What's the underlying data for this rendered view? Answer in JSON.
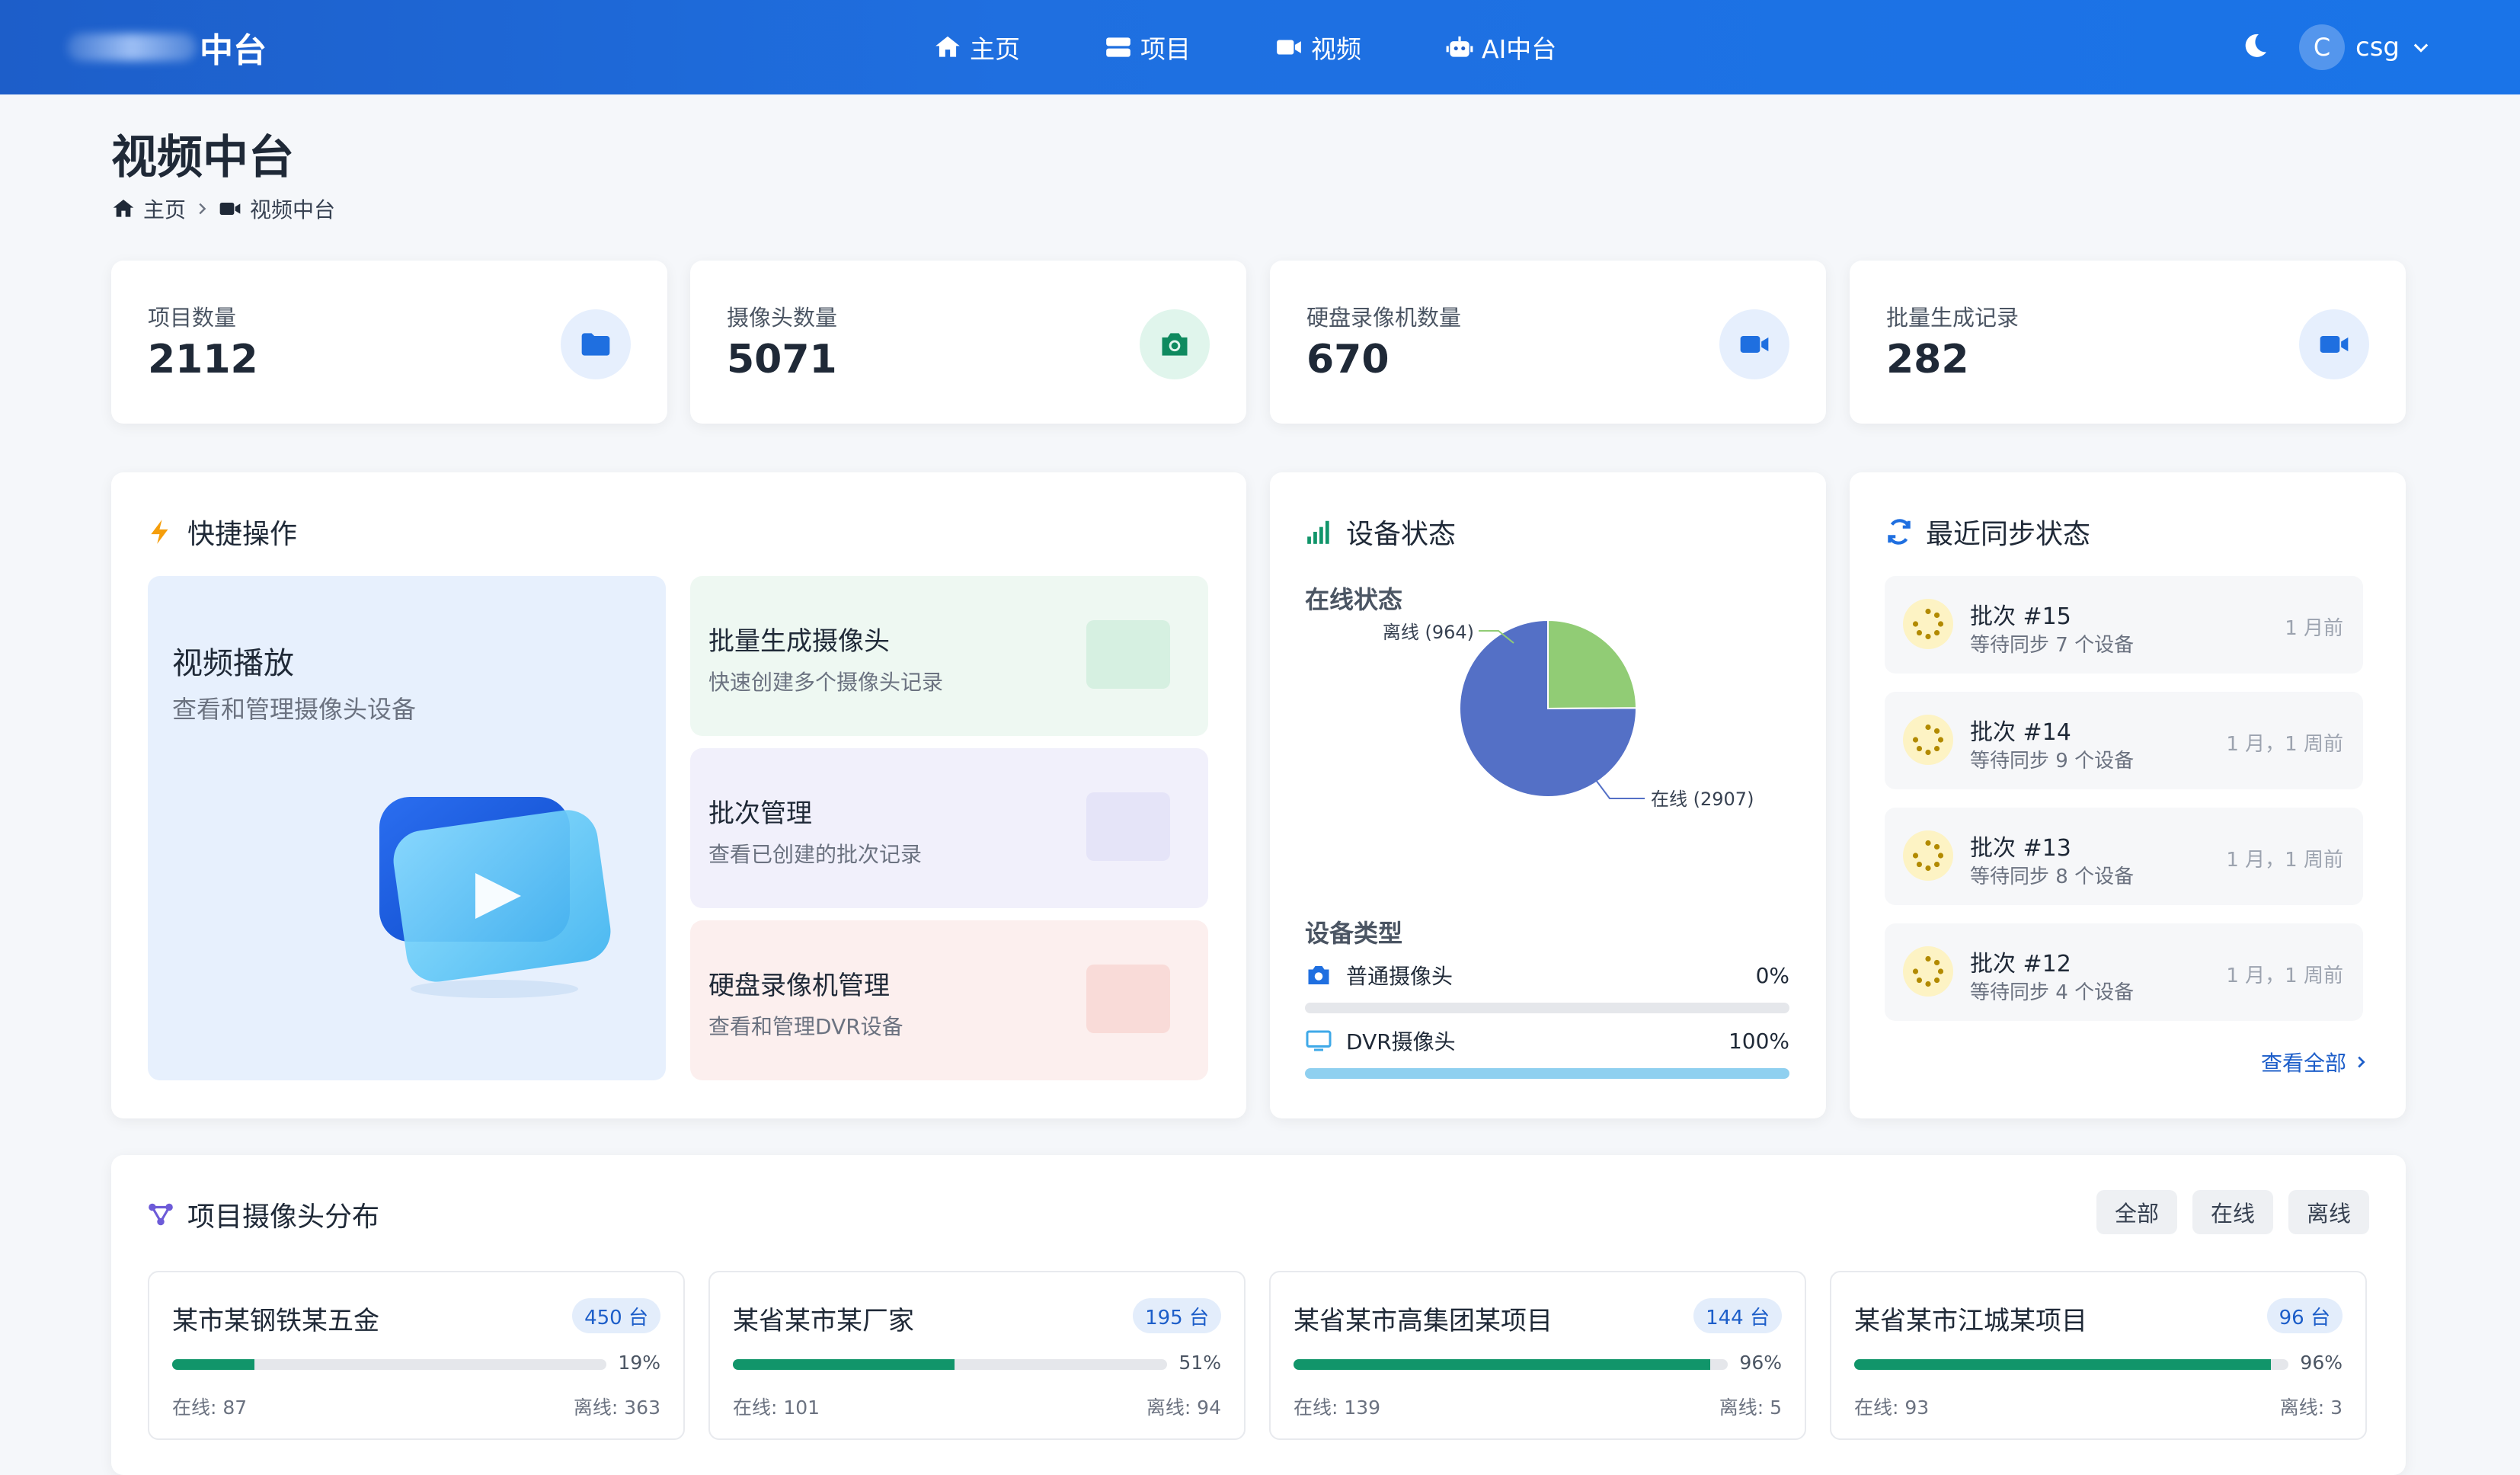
{
  "header": {
    "brand_suffix": "中台",
    "nav": [
      {
        "label": "主页",
        "icon": "home-icon"
      },
      {
        "label": "项目",
        "icon": "server-icon"
      },
      {
        "label": "视频",
        "icon": "video-icon"
      },
      {
        "label": "AI中台",
        "icon": "robot-icon"
      }
    ],
    "user": {
      "initial": "C",
      "name": "csg"
    }
  },
  "page": {
    "title": "视频中台",
    "breadcrumb": [
      "主页",
      "视频中台"
    ]
  },
  "stats": [
    {
      "label": "项目数量",
      "value": "2112",
      "icon": "folder-icon",
      "color": "#1f6fe0",
      "bg": "#e6effd"
    },
    {
      "label": "摄像头数量",
      "value": "5071",
      "icon": "camera-icon",
      "color": "#0f8a5f",
      "bg": "#e0f5ec"
    },
    {
      "label": "硬盘录像机数量",
      "value": "670",
      "icon": "video-camera-icon",
      "color": "#1f6fe0",
      "bg": "#e6effd"
    },
    {
      "label": "批量生成记录",
      "value": "282",
      "icon": "video-camera-icon",
      "color": "#1f6fe0",
      "bg": "#e6effd"
    }
  ],
  "quick_actions": {
    "title": "快捷操作",
    "main": {
      "title": "视频播放",
      "subtitle": "查看和管理摄像头设备"
    },
    "items": [
      {
        "title": "批量生成摄像头",
        "subtitle": "快速创建多个摄像头记录",
        "bg": "#eef8f2"
      },
      {
        "title": "批次管理",
        "subtitle": "查看已创建的批次记录",
        "bg": "#f1f0fb"
      },
      {
        "title": "硬盘录像机管理",
        "subtitle": "查看和管理DVR设备",
        "bg": "#fcefee"
      }
    ]
  },
  "device_status": {
    "title": "设备状态",
    "online_title": "在线状态",
    "offline_label": "离线 (964)",
    "online_label": "在线 (2907)",
    "type_title": "设备类型",
    "types": [
      {
        "label": "普通摄像头",
        "percent": "0%",
        "fraction": 0.0,
        "icon": "camera-icon"
      },
      {
        "label": "DVR摄像头",
        "percent": "100%",
        "fraction": 1.0,
        "icon": "monitor-icon"
      }
    ]
  },
  "chart_data": {
    "type": "pie",
    "title": "在线状态",
    "slices": [
      {
        "label": "离线",
        "value": 964,
        "color": "#91cc75"
      },
      {
        "label": "在线",
        "value": 2907,
        "color": "#5470c6"
      }
    ]
  },
  "sync_status": {
    "title": "最近同步状态",
    "items": [
      {
        "name": "批次 #15",
        "desc": "等待同步 7 个设备",
        "time": "1 月前"
      },
      {
        "name": "批次 #14",
        "desc": "等待同步 9 个设备",
        "time": "1 月，1 周前"
      },
      {
        "name": "批次 #13",
        "desc": "等待同步 8 个设备",
        "time": "1 月，1 周前"
      },
      {
        "name": "批次 #12",
        "desc": "等待同步 4 个设备",
        "time": "1 月，1 周前"
      }
    ],
    "view_all": "查看全部"
  },
  "distribution": {
    "title": "项目摄像头分布",
    "filters": [
      "全部",
      "在线",
      "离线"
    ],
    "projects": [
      {
        "name": "某市某钢铁某五金",
        "count": "450 台",
        "percent": "19%",
        "fraction": 0.19,
        "online": "在线: 87",
        "offline": "离线: 363"
      },
      {
        "name": "某省某市某厂家",
        "count": "195 台",
        "percent": "51%",
        "fraction": 0.51,
        "online": "在线: 101",
        "offline": "离线: 94"
      },
      {
        "name": "某省某市高集团某项目",
        "count": "144 台",
        "percent": "96%",
        "fraction": 0.96,
        "online": "在线: 139",
        "offline": "离线: 5"
      },
      {
        "name": "某省某市江城某项目",
        "count": "96 台",
        "percent": "96%",
        "fraction": 0.96,
        "online": "在线: 93",
        "offline": "离线: 3"
      }
    ]
  },
  "colors": {
    "primary": "#1f6fe0",
    "green": "#11956a",
    "bar_dvr": "#8fd0f0"
  }
}
